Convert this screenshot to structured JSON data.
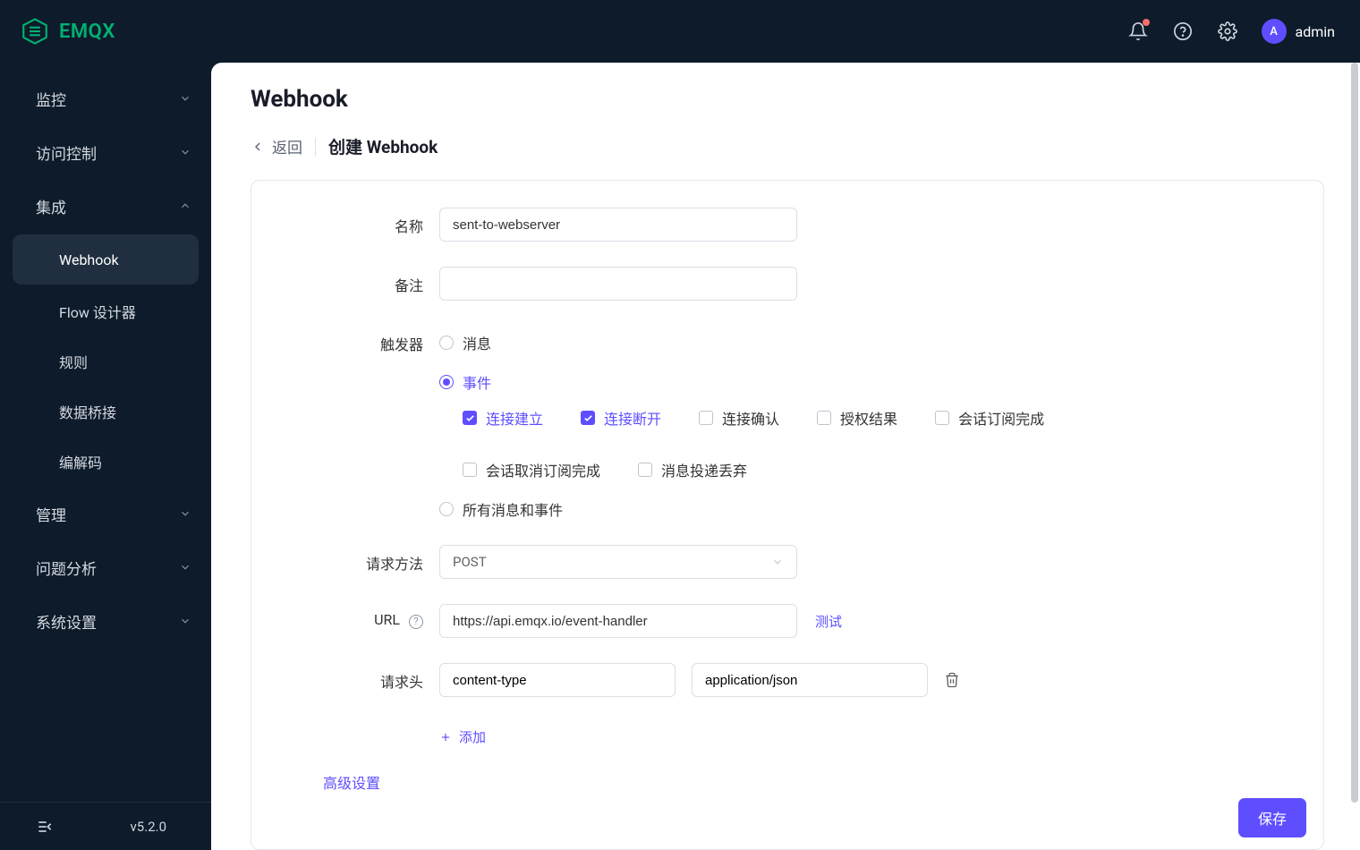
{
  "brand": {
    "name": "EMQX"
  },
  "user": {
    "initial": "A",
    "name": "admin"
  },
  "sidebar": {
    "items": [
      {
        "label": "监控",
        "type": "group"
      },
      {
        "label": "访问控制",
        "type": "group"
      },
      {
        "label": "集成",
        "type": "group-open"
      },
      {
        "label": "Webhook",
        "type": "child",
        "active": true
      },
      {
        "label": "Flow 设计器",
        "type": "child"
      },
      {
        "label": "规则",
        "type": "child"
      },
      {
        "label": "数据桥接",
        "type": "child"
      },
      {
        "label": "编解码",
        "type": "child"
      },
      {
        "label": "管理",
        "type": "group"
      },
      {
        "label": "问题分析",
        "type": "group"
      },
      {
        "label": "系统设置",
        "type": "group"
      }
    ],
    "version": "v5.2.0"
  },
  "page": {
    "title": "Webhook",
    "back": "返回",
    "breadcrumb": "创建 Webhook"
  },
  "form": {
    "name_label": "名称",
    "name_value": "sent-to-webserver",
    "remark_label": "备注",
    "remark_value": "",
    "trigger_label": "触发器",
    "trigger_options": {
      "message": "消息",
      "event": "事件",
      "all": "所有消息和事件"
    },
    "trigger_selected": "event",
    "events": [
      {
        "label": "连接建立",
        "checked": true
      },
      {
        "label": "连接断开",
        "checked": true
      },
      {
        "label": "连接确认",
        "checked": false
      },
      {
        "label": "授权结果",
        "checked": false
      },
      {
        "label": "会话订阅完成",
        "checked": false
      },
      {
        "label": "会话取消订阅完成",
        "checked": false
      },
      {
        "label": "消息投递丢弃",
        "checked": false
      }
    ],
    "method_label": "请求方法",
    "method_value": "POST",
    "url_label": "URL",
    "url_value": "https://api.emqx.io/event-handler",
    "test_label": "测试",
    "headers_label": "请求头",
    "headers": [
      {
        "key": "content-type",
        "value": "application/json"
      }
    ],
    "add_label": "添加",
    "advanced_label": "高级设置",
    "save_label": "保存"
  }
}
